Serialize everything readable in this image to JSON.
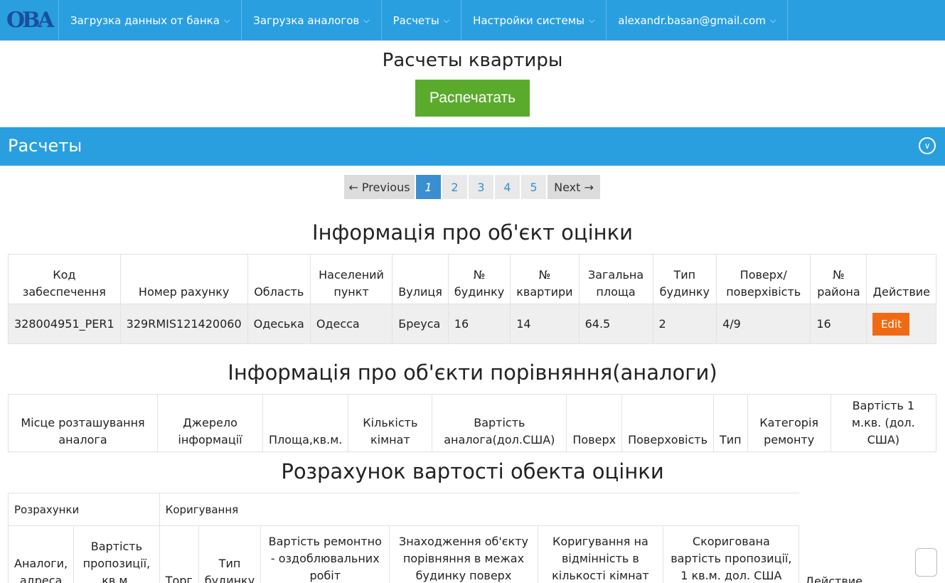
{
  "navbar": {
    "logo": "ОВА",
    "items": [
      "Загрузка данных от банка",
      "Загрузка аналогов",
      "Расчеты",
      "Настройки системы",
      "alexandr.basan@gmail.com"
    ]
  },
  "page_title": "Расчеты квартиры",
  "print_button": "Распечатать",
  "panel_title": "Расчеты",
  "pagination": {
    "prev": "← Previous",
    "pages": [
      "1",
      "2",
      "3",
      "4",
      "5"
    ],
    "current": "1",
    "next": "Next →"
  },
  "object_section": {
    "title": "Інформація про об'єкт оцінки",
    "headers": [
      "Код забеспечення",
      "Номер рахунку",
      "Область",
      "Населений пункт",
      "Вулиця",
      "№ будинку",
      "№ квартири",
      "Загальна площа",
      "Тип будинку",
      "Поверх/ поверхівість",
      "№ района",
      "Действие"
    ],
    "rows": [
      [
        "328004951_PER1",
        "329RMIS121420060",
        "Одеська",
        "Одесса",
        "Бреуса",
        "16",
        "14",
        "64.5",
        "2",
        "4/9",
        "16"
      ]
    ],
    "edit_label": "Edit"
  },
  "analogs_section": {
    "title": "Інформація про об'єкти порівняння(аналоги)",
    "headers": [
      "Місце розташування аналога",
      "Джерело інформації",
      "Площа,кв.м.",
      "Кількість кімнат",
      "Вартість аналога(дол.США)",
      "Поверх",
      "Поверховість",
      "Тип",
      "Категорія ремонту",
      "Вартість 1 м.кв. (дол. США)"
    ]
  },
  "calc_section": {
    "title": "Розрахунок вартості обекта оцінки",
    "group_calc": "Розрахунки",
    "group_corr": "Коригування",
    "headers": [
      "Аналоги, адреса",
      "Вартість пропозиції, кв.м.",
      "Торг",
      "Тип будинку",
      "Вартість ремонтно - оздоблювальних робіт",
      "Знаходження об'єкту порівняння в межах будинку поверх",
      "Коригування на відмінність в кількості кімнат",
      "Скоригована вартість пропозиції, 1 кв.м. дол. США",
      "Действие"
    ]
  }
}
